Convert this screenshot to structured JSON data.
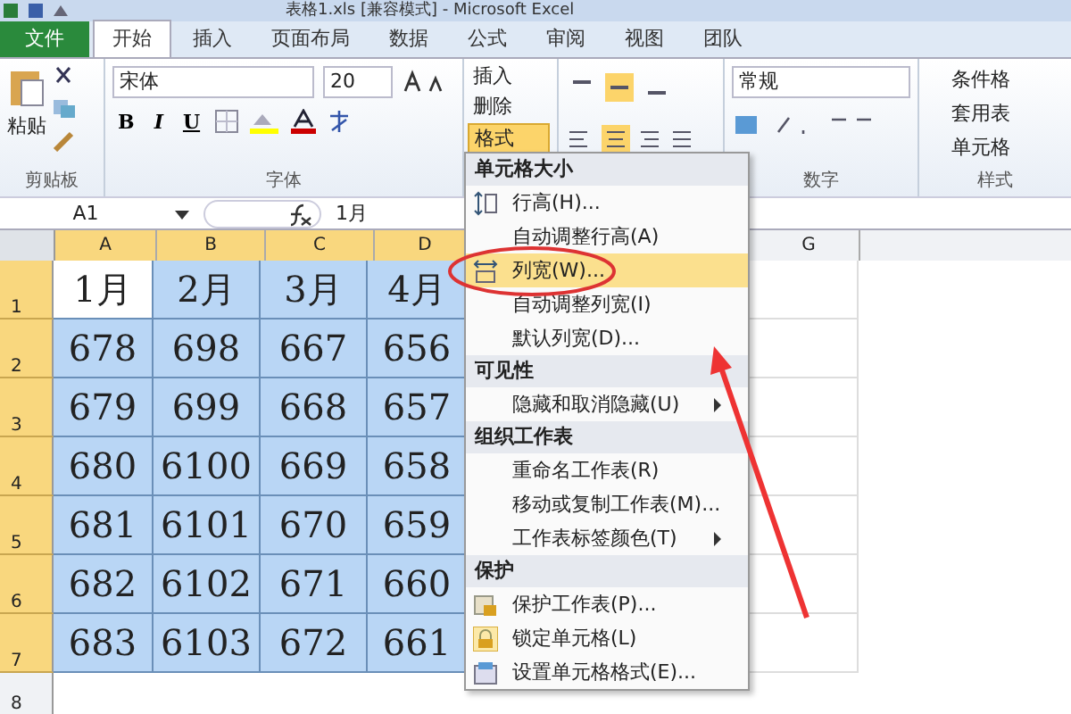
{
  "window": {
    "title": "表格1.xls [兼容模式] - Microsoft Excel"
  },
  "tabs": [
    {
      "label": "文件",
      "kind": "file",
      "selected": false
    },
    {
      "label": "开始",
      "kind": "tab",
      "selected": true
    },
    {
      "label": "插入",
      "kind": "tab",
      "selected": false
    },
    {
      "label": "页面布局",
      "kind": "tab",
      "selected": false
    },
    {
      "label": "数据",
      "kind": "tab",
      "selected": false
    },
    {
      "label": "公式",
      "kind": "tab",
      "selected": false
    },
    {
      "label": "审阅",
      "kind": "tab",
      "selected": false
    },
    {
      "label": "视图",
      "kind": "tab",
      "selected": false
    },
    {
      "label": "团队",
      "kind": "tab",
      "selected": false
    }
  ],
  "ribbon": {
    "clipboard": {
      "paste": "粘贴",
      "group_label": "剪贴板"
    },
    "font": {
      "name": "宋体",
      "size": "20",
      "styles": [
        "B",
        "I",
        "U"
      ],
      "group_label": "字体"
    },
    "cells": [
      {
        "label": "插入",
        "selected": false
      },
      {
        "label": "删除",
        "selected": false
      },
      {
        "label": "格式",
        "selected": true
      }
    ],
    "number": {
      "format": "常规",
      "group_label": "数字"
    },
    "styles": {
      "items": [
        "条件格",
        "套用表",
        "单元格"
      ],
      "group_label": "样式"
    }
  },
  "formula_bar": {
    "name_box": "A1",
    "value": "1月"
  },
  "sheet": {
    "columns": [
      "A",
      "B",
      "C",
      "D"
    ],
    "right_columns": [
      "G"
    ],
    "rows": [
      {
        "header": "1",
        "cells": [
          {
            "text": "1月",
            "active": true
          },
          {
            "text": "2月",
            "active": false
          },
          {
            "text": "3月",
            "active": false
          },
          {
            "text": "4月",
            "active": false
          }
        ]
      },
      {
        "header": "2",
        "cells": [
          {
            "text": "678",
            "active": false
          },
          {
            "text": "698",
            "active": false
          },
          {
            "text": "667",
            "active": false
          },
          {
            "text": "656",
            "active": false
          }
        ]
      },
      {
        "header": "3",
        "cells": [
          {
            "text": "679",
            "active": false
          },
          {
            "text": "699",
            "active": false
          },
          {
            "text": "668",
            "active": false
          },
          {
            "text": "657",
            "active": false
          }
        ]
      },
      {
        "header": "4",
        "cells": [
          {
            "text": "680",
            "active": false
          },
          {
            "text": "6100",
            "active": false
          },
          {
            "text": "669",
            "active": false
          },
          {
            "text": "658",
            "active": false
          }
        ]
      },
      {
        "header": "5",
        "cells": [
          {
            "text": "681",
            "active": false
          },
          {
            "text": "6101",
            "active": false
          },
          {
            "text": "670",
            "active": false
          },
          {
            "text": "659",
            "active": false
          }
        ]
      },
      {
        "header": "6",
        "cells": [
          {
            "text": "682",
            "active": false
          },
          {
            "text": "6102",
            "active": false
          },
          {
            "text": "671",
            "active": false
          },
          {
            "text": "660",
            "active": false
          }
        ]
      },
      {
        "header": "7",
        "cells": [
          {
            "text": "683",
            "active": false
          },
          {
            "text": "6103",
            "active": false
          },
          {
            "text": "672",
            "active": false
          },
          {
            "text": "661",
            "active": false
          }
        ]
      }
    ],
    "empty_row": "8"
  },
  "menu": [
    {
      "heading": "单元格大小",
      "items": [
        {
          "label": "行高(H)...",
          "highlighted": false,
          "submenu": false
        },
        {
          "label": "自动调整行高(A)",
          "highlighted": false,
          "submenu": false
        },
        {
          "label": "列宽(W)...",
          "highlighted": true,
          "submenu": false
        },
        {
          "label": "自动调整列宽(I)",
          "highlighted": false,
          "submenu": false
        },
        {
          "label": "默认列宽(D)...",
          "highlighted": false,
          "submenu": false
        }
      ]
    },
    {
      "heading": "可见性",
      "items": [
        {
          "label": "隐藏和取消隐藏(U)",
          "highlighted": false,
          "submenu": true
        }
      ]
    },
    {
      "heading": "组织工作表",
      "items": [
        {
          "label": "重命名工作表(R)",
          "highlighted": false,
          "submenu": false
        },
        {
          "label": "移动或复制工作表(M)...",
          "highlighted": false,
          "submenu": false
        },
        {
          "label": "工作表标签颜色(T)",
          "highlighted": false,
          "submenu": true
        }
      ]
    },
    {
      "heading": "保护",
      "items": [
        {
          "label": "保护工作表(P)...",
          "highlighted": false,
          "submenu": false
        },
        {
          "label": "锁定单元格(L)",
          "highlighted": false,
          "submenu": false
        },
        {
          "label": "设置单元格格式(E)...",
          "highlighted": false,
          "submenu": false
        }
      ]
    }
  ]
}
